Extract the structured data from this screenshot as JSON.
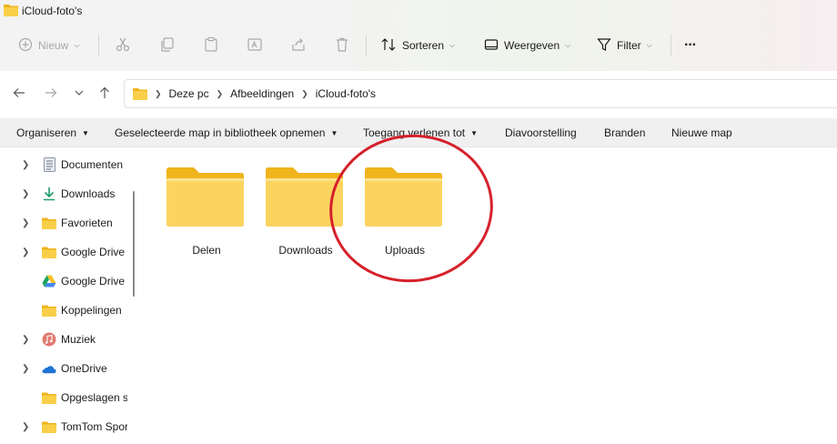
{
  "window": {
    "title": "iCloud-foto's"
  },
  "toolbar": {
    "new_label": "Nieuw",
    "sort_label": "Sorteren",
    "view_label": "Weergeven",
    "filter_label": "Filter",
    "more_label": "···"
  },
  "address": {
    "crumbs": [
      "Deze pc",
      "Afbeeldingen",
      "iCloud-foto's"
    ]
  },
  "ribbon": {
    "organize": "Organiseren",
    "library": "Geselecteerde map in bibliotheek opnemen",
    "share": "Toegang verlenen tot",
    "slideshow": "Diavoorstelling",
    "burn": "Branden",
    "new_folder": "Nieuwe map"
  },
  "sidebar": {
    "items": [
      {
        "label": "Documenten",
        "icon": "document-icon"
      },
      {
        "label": "Downloads",
        "icon": "download-icon"
      },
      {
        "label": "Favorieten",
        "icon": "folder-icon"
      },
      {
        "label": "Google Drive",
        "icon": "folder-icon"
      },
      {
        "label": "Google Drive",
        "icon": "google-drive-icon"
      },
      {
        "label": "Koppelingen",
        "icon": "folder-icon"
      },
      {
        "label": "Muziek",
        "icon": "music-icon"
      },
      {
        "label": "OneDrive",
        "icon": "cloud-icon"
      },
      {
        "label": "Opgeslagen s",
        "icon": "folder-icon"
      },
      {
        "label": "TomTom Spor",
        "icon": "folder-icon"
      }
    ]
  },
  "folders": [
    {
      "name": "Delen"
    },
    {
      "name": "Downloads"
    },
    {
      "name": "Uploads"
    }
  ],
  "colors": {
    "folder_front": "#f9cf4a",
    "folder_back": "#f0b41c",
    "highlight_circle": "#d6212b"
  }
}
